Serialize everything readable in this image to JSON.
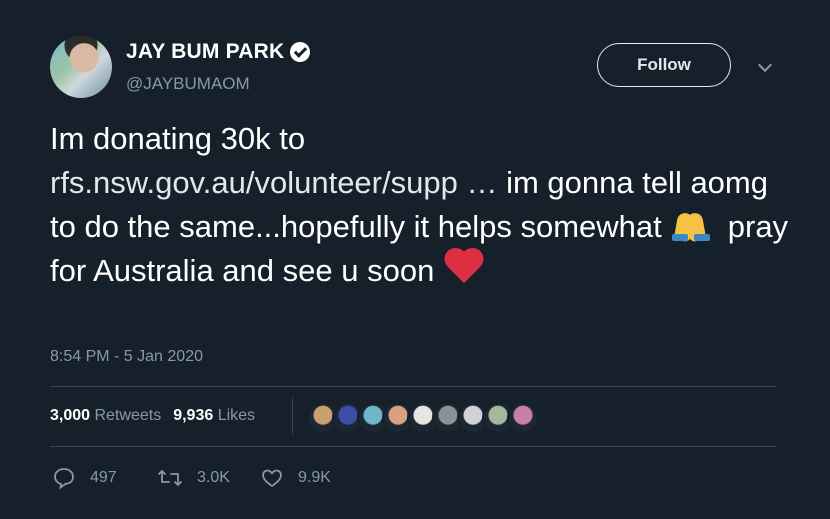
{
  "author": {
    "name": "JAY BUM PARK",
    "handle": "@JAYBUMAOM",
    "verified": true
  },
  "follow_button": {
    "label": "Follow"
  },
  "tweet": {
    "line_1": "Im donating 30k to",
    "link": "rfs.nsw.gov.au/volunteer/supp …",
    "text_after_link": " im gonna tell aomg to do the same...hopefully it helps somewhat",
    "text_after_emoji": "pray for Australia and see u soon",
    "emojis": [
      "folded-hands",
      "red-heart"
    ]
  },
  "timestamp": "8:54 PM - 5 Jan 2020",
  "stats": {
    "retweets_count": "3,000",
    "retweets_label": "Retweets",
    "likes_count": "9,936",
    "likes_label": "Likes"
  },
  "liker_avatars": [
    "#c9a06b",
    "#3b4fa8",
    "#6fb7c7",
    "#d8a07f",
    "#e8e4e0",
    "#8c8f94",
    "#cfd2d6",
    "#a3b99a",
    "#c77fa8"
  ],
  "actions": {
    "replies": "497",
    "retweets": "3.0K",
    "likes": "9.9K"
  },
  "colors": {
    "background": "#15202b",
    "text_secondary": "#8899a6",
    "divider": "#38444d",
    "heart": "#dd2e44"
  }
}
